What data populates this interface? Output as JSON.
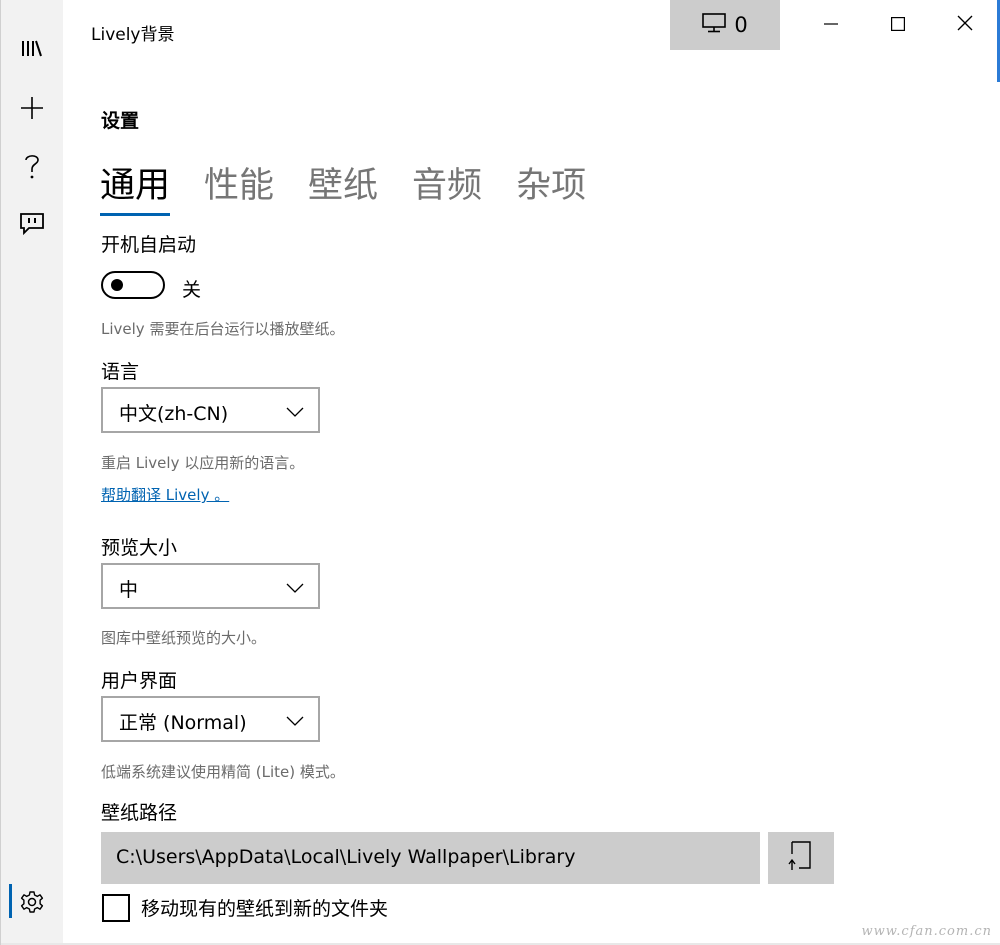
{
  "window": {
    "title": "Lively背景",
    "monitor_count": "0"
  },
  "sidebar": {
    "items": [
      {
        "icon": "library-icon"
      },
      {
        "icon": "add-icon"
      },
      {
        "icon": "help-icon"
      },
      {
        "icon": "feedback-icon"
      },
      {
        "icon": "settings-icon",
        "selected": true
      }
    ]
  },
  "settings": {
    "page_title": "设置",
    "tabs": [
      {
        "label": "通用",
        "active": true
      },
      {
        "label": "性能"
      },
      {
        "label": "壁纸"
      },
      {
        "label": "音频"
      },
      {
        "label": "杂项"
      }
    ],
    "startup": {
      "label": "开机自启动",
      "toggle_state": "关",
      "hint": "Lively 需要在后台运行以播放壁纸。"
    },
    "language": {
      "label": "语言",
      "selected": "中文(zh-CN)",
      "hint": "重启 Lively 以应用新的语言。",
      "link": "帮助翻译 Lively 。"
    },
    "preview_size": {
      "label": "预览大小",
      "selected": "中",
      "hint": "图库中壁纸预览的大小。"
    },
    "ui_mode": {
      "label": "用户界面",
      "selected": "正常 (Normal)",
      "hint": "低端系统建议使用精简 (Lite) 模式。"
    },
    "wallpaper_path": {
      "label": "壁纸路径",
      "value": "C:\\Users\\AppData\\Local\\Lively Wallpaper\\Library",
      "move_checkbox_label": "移动现有的壁纸到新的文件夹",
      "move_checked": false
    }
  },
  "watermark": "www.cfan.com.cn",
  "colors": {
    "accent": "#0063b1",
    "sidebar_bg": "#f2f2f2",
    "control_gray": "#cccccc"
  }
}
